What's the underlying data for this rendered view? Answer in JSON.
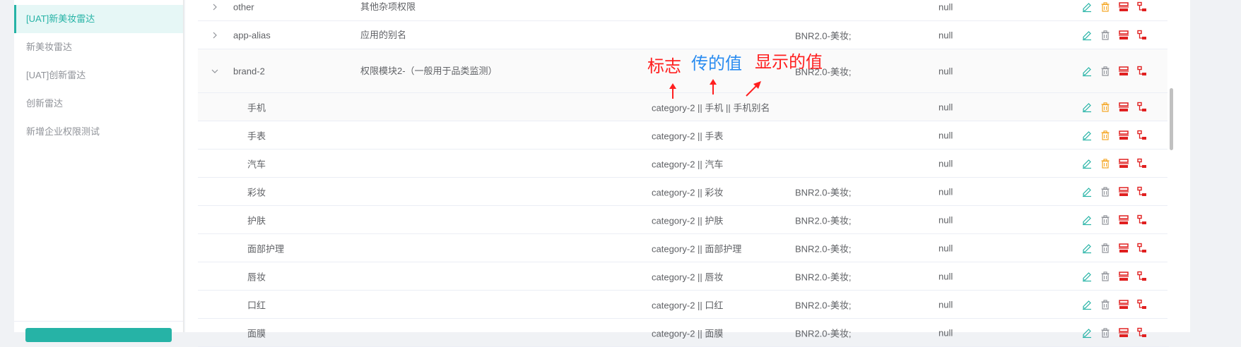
{
  "sidebar": {
    "items": [
      {
        "label": "[UAT]新美妆雷达",
        "active": true
      },
      {
        "label": "新美妆雷达"
      },
      {
        "label": "[UAT]创新雷达"
      },
      {
        "label": "创新雷达"
      },
      {
        "label": "新增企业权限测试"
      }
    ]
  },
  "rows": [
    {
      "name": "other",
      "description": "其他杂项权限",
      "value": "",
      "category": "",
      "null_text": "null",
      "expander": "collapsed"
    },
    {
      "name": "app-alias",
      "description": "应用的别名",
      "value": "",
      "category": "BNR2.0-美妆;",
      "null_text": "null",
      "expander": "collapsed"
    },
    {
      "name": "brand-2",
      "description": "权限模块2-（一般用于品类监测）",
      "value": "",
      "category": "BNR2.0-美妆;",
      "null_text": "null",
      "expander": "expanded"
    },
    {
      "name": "手机",
      "description": "",
      "value": "category-2 || 手机 || 手机别名",
      "category": "",
      "null_text": "null"
    },
    {
      "name": "手表",
      "description": "",
      "value": "category-2 || 手表",
      "category": "",
      "null_text": "null"
    },
    {
      "name": "汽车",
      "description": "",
      "value": "category-2 || 汽车",
      "category": "",
      "null_text": "null"
    },
    {
      "name": "彩妆",
      "description": "",
      "value": "category-2 || 彩妆",
      "category": "BNR2.0-美妆;",
      "null_text": "null"
    },
    {
      "name": "护肤",
      "description": "",
      "value": "category-2 || 护肤",
      "category": "BNR2.0-美妆;",
      "null_text": "null"
    },
    {
      "name": "面部护理",
      "description": "",
      "value": "category-2 || 面部护理",
      "category": "BNR2.0-美妆;",
      "null_text": "null"
    },
    {
      "name": "唇妆",
      "description": "",
      "value": "category-2 || 唇妆",
      "category": "BNR2.0-美妆;",
      "null_text": "null"
    },
    {
      "name": "口红",
      "description": "",
      "value": "category-2 || 口红",
      "category": "BNR2.0-美妆;",
      "null_text": "null"
    },
    {
      "name": "面膜",
      "description": "",
      "value": "category-2 || 面膜",
      "category": "BNR2.0-美妆;",
      "null_text": "null"
    }
  ],
  "annotations": {
    "flag": "标志",
    "passed_value": "传的值",
    "display_value": "显示的值"
  },
  "colors": {
    "accent": "#26b3a6",
    "edit_icon": "#26b3a6",
    "delete_icon_default": "#909399",
    "delete_icon_orange": "#f5a623",
    "red_icon": "#e02020",
    "annotation_red": "#ff1f1f",
    "annotation_blue": "#2a8cf0"
  },
  "icons": {
    "expander_collapsed": "chevron-right-icon",
    "expander_expanded": "chevron-down-icon",
    "actions": [
      "edit-icon",
      "delete-icon",
      "add-sibling-icon",
      "add-child-icon"
    ]
  }
}
